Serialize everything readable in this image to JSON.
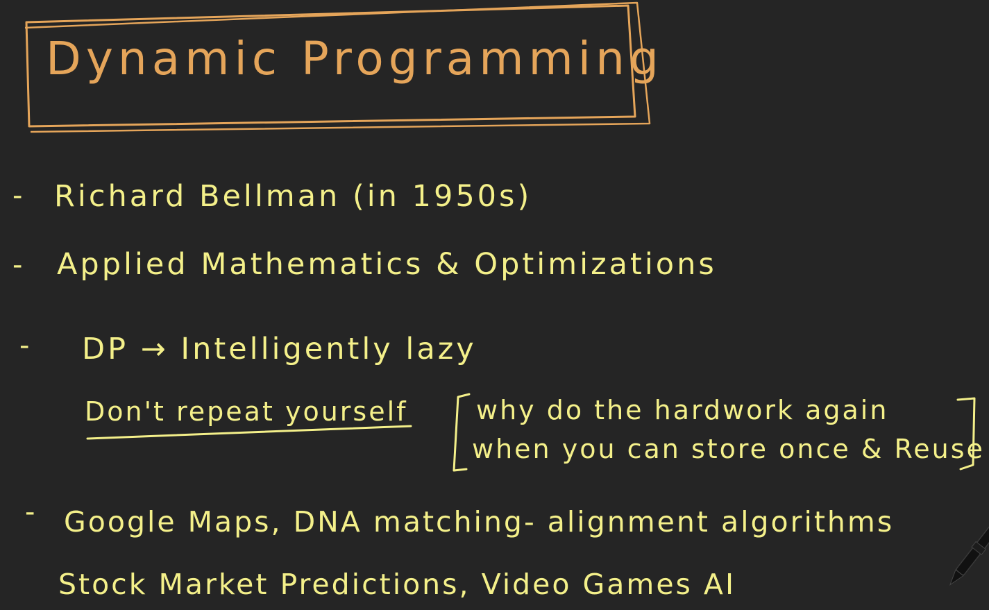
{
  "colors": {
    "background": "#252525",
    "title_ink": "#e5a55a",
    "body_ink": "#f4f08a",
    "pen_cursor": "#111111"
  },
  "title": "Dynamic Programming",
  "bullets": [
    {
      "dash": "-",
      "text": "Richard Bellman (in 1950s)"
    },
    {
      "dash": "-",
      "text": "Applied Mathematics & Optimizations"
    },
    {
      "dash": "-",
      "text": "DP → Intelligently lazy"
    },
    {
      "dash": "-",
      "text": "Google Maps, DNA matching- alignment algorithms"
    }
  ],
  "dry_note": {
    "label": "Don't repeat yourself",
    "bracket_line_1": "why do the hardwork again",
    "bracket_line_2": "when you can store once & Reuse"
  },
  "continuation": "Stock Market Predictions, Video Games AI",
  "icons": {
    "cursor": "pen-cursor-icon"
  }
}
